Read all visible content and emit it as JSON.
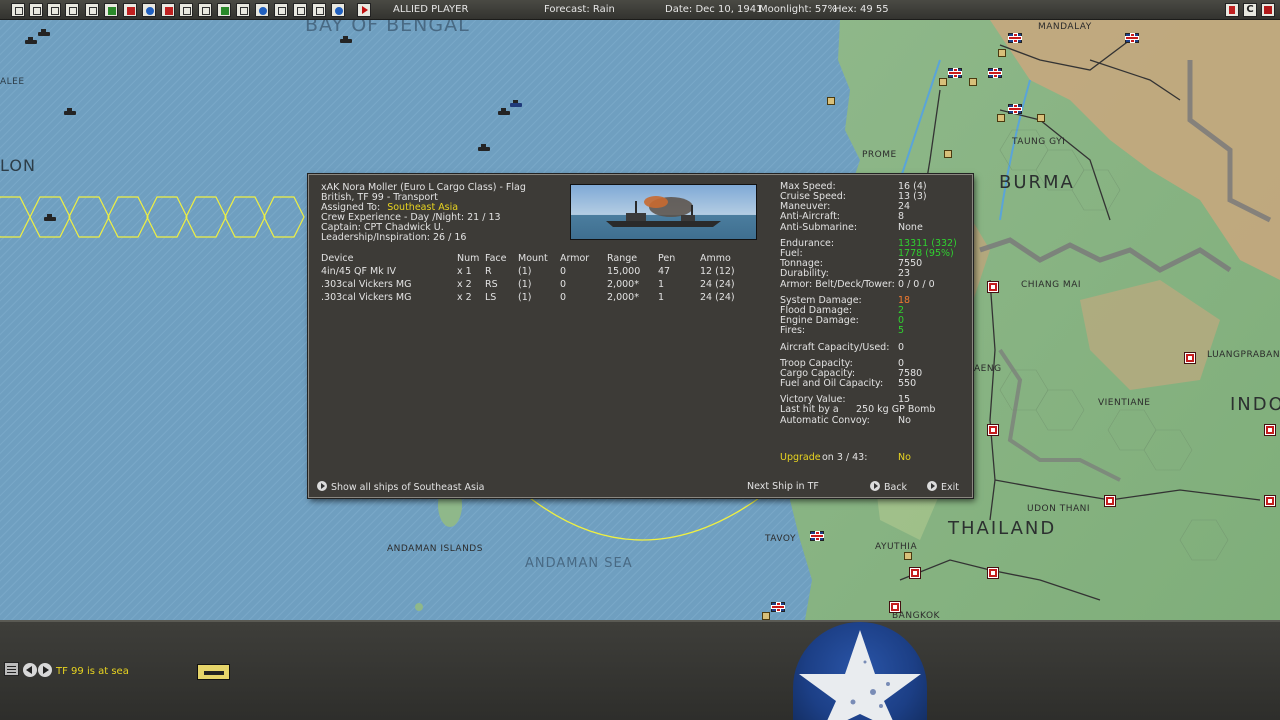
{
  "topbar": {
    "player": "ALLIED PLAYER",
    "forecast": "Forecast: Rain",
    "date": "Date: Dec 10, 1941",
    "moonlight": "Moonlight: 57%",
    "hex": "Hex: 49 55",
    "right_buttons": [
      "C"
    ]
  },
  "map": {
    "labels": {
      "bay_of_bengal": "BAY OF BENGAL",
      "alee": "ALEE",
      "lon": "LON",
      "mandalay": "MANDALAY",
      "prome": "PROME",
      "taung_gyi": "TAUNG GYI",
      "burma": "BURMA",
      "chiang_mai": "CHIANG MAI",
      "luangprabang": "LUANGPRABANG",
      "aeng": "AENG",
      "vientiane": "VIENTIANE",
      "indo": "INDO",
      "udon_thani": "UDON THANI",
      "thailand": "THAILAND",
      "andaman_islands": "ANDAMAN ISLANDS",
      "andaman_sea": "ANDAMAN SEA",
      "tavoy": "TAVOY",
      "ayuthia": "AYUTHIA",
      "bangkok": "BANGKOK"
    },
    "colors": {
      "sea": "#6f9fc0",
      "land": "#8fb88a",
      "highland": "#c9a77e",
      "hex_highlight": "#f0f040",
      "border_line": "#7a7a7a"
    }
  },
  "dialog": {
    "title": "xAK Nora Moller (Euro L Cargo Class)  - Flag",
    "nation_tf": "British, TF 99 - Transport",
    "assigned_label": "Assigned To:",
    "assigned_value": "Southeast Asia",
    "crew_exp": "Crew Experience - Day /Night:  21 / 13",
    "captain": "Captain:  CPT Chadwick U.",
    "leadership": "Leadership/Inspiration: 26 / 16",
    "devices": {
      "headers": [
        "Device",
        "Num",
        "Face",
        "Mount",
        "Armor",
        "Range",
        "Pen",
        "Ammo"
      ],
      "rows": [
        [
          "4in/45 QF Mk IV",
          "x 1",
          "R",
          "(1)",
          "0",
          "15,000",
          "47",
          "12  (12)"
        ],
        [
          ".303cal Vickers MG",
          "x 2",
          "RS",
          "(1)",
          "0",
          "2,000*",
          "1",
          "24  (24)"
        ],
        [
          ".303cal Vickers MG",
          "x 2",
          "LS",
          "(1)",
          "0",
          "2,000*",
          "1",
          "24  (24)"
        ]
      ]
    },
    "stats": [
      {
        "k": "Max Speed:",
        "v": "16 (4)",
        "c": ""
      },
      {
        "k": "Cruise Speed:",
        "v": "13 (3)",
        "c": ""
      },
      {
        "k": "Maneuver:",
        "v": "24",
        "c": ""
      },
      {
        "k": "Anti-Aircraft:",
        "v": "8",
        "c": ""
      },
      {
        "k": "Anti-Submarine:",
        "v": "None",
        "c": ""
      },
      {
        "k": "Endurance:",
        "v": "13311  (332)",
        "c": "green"
      },
      {
        "k": "Fuel:",
        "v": "1778  (95%)",
        "c": "green"
      },
      {
        "k": "Tonnage:",
        "v": "7550",
        "c": ""
      },
      {
        "k": "Durability:",
        "v": "23",
        "c": ""
      },
      {
        "k": "Armor: Belt/Deck/Tower:",
        "v": "0 / 0 / 0",
        "c": ""
      },
      {
        "k": "System Damage:",
        "v": "18",
        "c": "orange"
      },
      {
        "k": "Flood Damage:",
        "v": "2",
        "c": "green"
      },
      {
        "k": "Engine Damage:",
        "v": "0",
        "c": "green"
      },
      {
        "k": "Fires:",
        "v": "5",
        "c": "green"
      },
      {
        "k": "Aircraft Capacity/Used:",
        "v": "0",
        "c": ""
      },
      {
        "k": "Troop Capacity:",
        "v": "0",
        "c": ""
      },
      {
        "k": "Cargo Capacity:",
        "v": "7580",
        "c": ""
      },
      {
        "k": "Fuel and Oil Capacity:",
        "v": "550",
        "c": ""
      },
      {
        "k": "Victory Value:",
        "v": "15",
        "c": ""
      },
      {
        "k": "Last hit by a",
        "v": "250 kg GP Bomb",
        "c": ""
      },
      {
        "k": "Automatic Convoy:",
        "v": "No",
        "c": ""
      }
    ],
    "upgrade_label": "Upgrade",
    "upgrade_on": "on  3 / 43:",
    "upgrade_value": "No",
    "show_all": "Show all ships of Southeast Asia",
    "next_ship": "Next Ship in TF",
    "back": "Back",
    "exit": "Exit"
  },
  "bottom": {
    "tf_status": "TF 99 is at sea"
  }
}
